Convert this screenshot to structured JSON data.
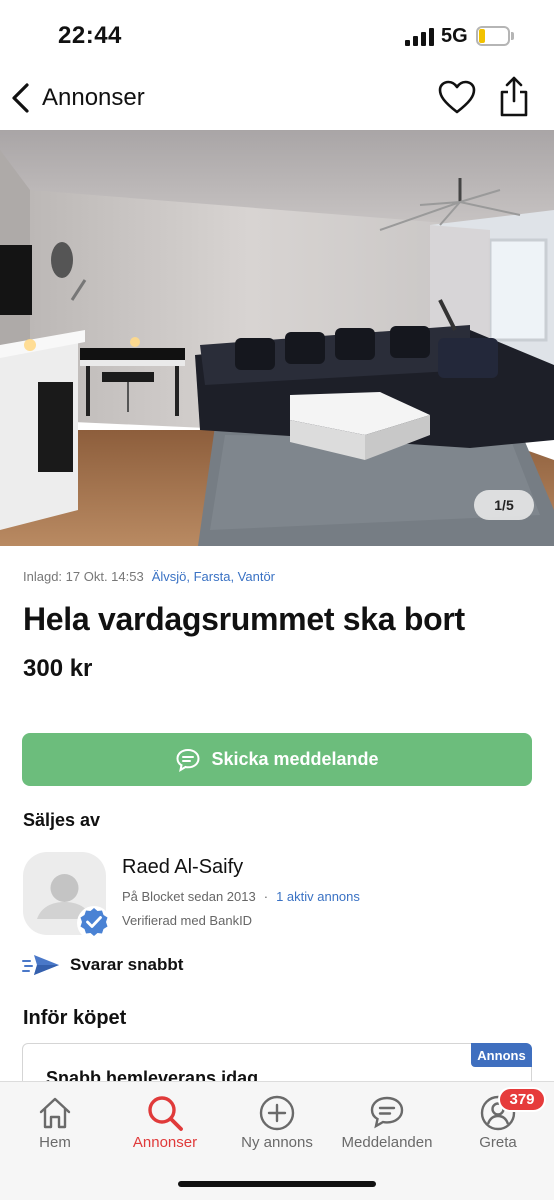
{
  "status_bar": {
    "time": "22:44",
    "network": "5G",
    "battery_level": 0.2
  },
  "nav": {
    "back_label": "Annonser",
    "back_icon": "chevron-left-icon",
    "favorite_icon": "heart-icon",
    "share_icon": "share-icon"
  },
  "photo": {
    "counter": "1/5"
  },
  "listing": {
    "posted": "Inlagd: 17 Okt. 14:53",
    "location": "Älvsjö, Farsta, Vantör",
    "title": "Hela vardagsrummet ska bort",
    "price": "300 kr"
  },
  "actions": {
    "message_label": "Skicka meddelande",
    "message_icon": "chat-bubble-icon",
    "button_color": "#6cbd7c"
  },
  "seller": {
    "heading": "Säljes av",
    "name": "Raed Al-Saify",
    "since": "På Blocket sedan 2013",
    "separator": "·",
    "active_ads": "1 aktiv annons",
    "verified": "Verifierad med BankID",
    "fast_reply": "Svarar snabbt"
  },
  "before_purchase": {
    "heading": "Inför köpet",
    "card_title": "Snabb hemleverans idag",
    "badge": "Annons"
  },
  "tab_bar": {
    "tabs": [
      {
        "label": "Hem",
        "icon": "home-icon"
      },
      {
        "label": "Annonser",
        "icon": "search-icon",
        "active": true
      },
      {
        "label": "Ny annons",
        "icon": "plus-circle-icon"
      },
      {
        "label": "Meddelanden",
        "icon": "chat-bubble-icon"
      },
      {
        "label": "Greta",
        "icon": "profile-icon"
      }
    ],
    "notification_count": "379",
    "active_color": "#e03a3a"
  }
}
